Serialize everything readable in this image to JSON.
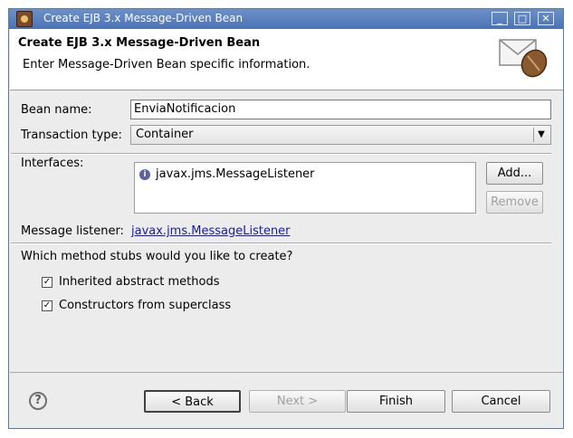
{
  "window": {
    "title": "Create EJB 3.x Message-Driven Bean",
    "controls": {
      "minimize": "_",
      "maximize": "□",
      "close": "✕"
    }
  },
  "header": {
    "title": "Create EJB 3.x Message-Driven Bean",
    "description": "Enter Message-Driven Bean specific information.",
    "icon": "envelope-bean-icon"
  },
  "form": {
    "bean_name_label": "Bean name:",
    "bean_name_value": "EnviaNotificacion",
    "transaction_type_label": "Transaction type:",
    "transaction_type_value": "Container",
    "interfaces_label": "Interfaces:",
    "interfaces": [
      "javax.jms.MessageListener"
    ],
    "add_button": "Add...",
    "remove_button": "Remove",
    "message_listener_label": "Message listener:",
    "message_listener_link": "javax.jms.MessageListener",
    "stubs_question": "Which method stubs would you like to create?",
    "checkbox_inherited": {
      "label": "Inherited abstract methods",
      "checked": true
    },
    "checkbox_constructors": {
      "label": "Constructors from superclass",
      "checked": true
    }
  },
  "footer": {
    "back_button": "< Back",
    "next_button": "Next >",
    "finish_button": "Finish",
    "cancel_button": "Cancel"
  }
}
